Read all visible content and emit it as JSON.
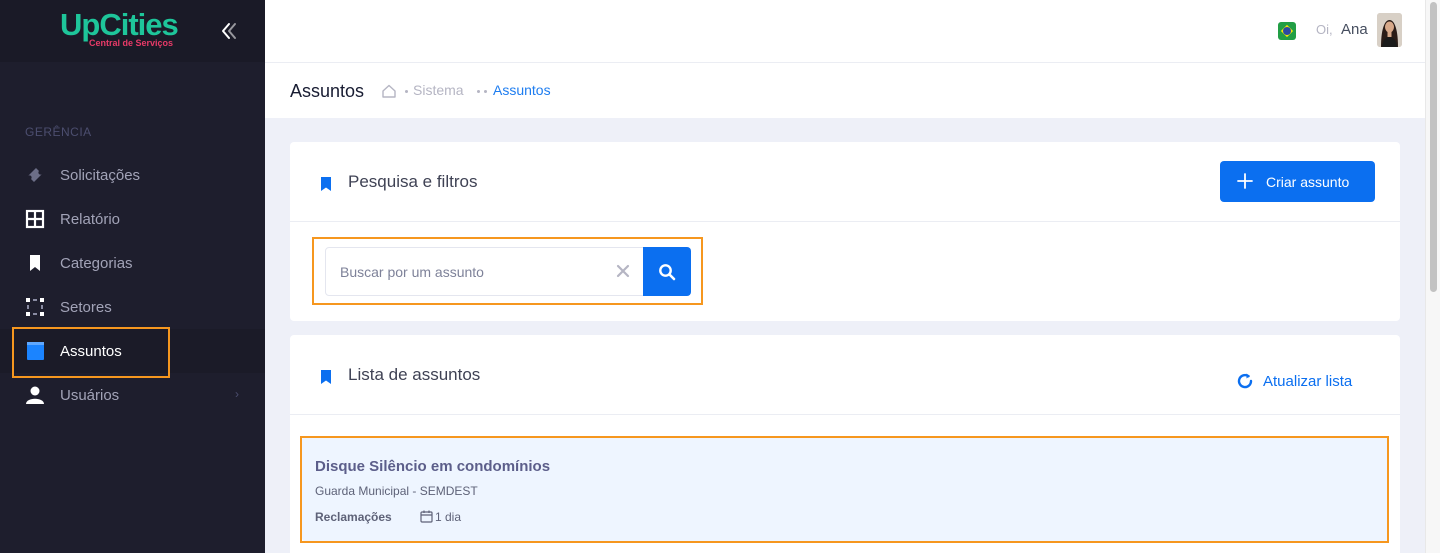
{
  "sidebar": {
    "logo": {
      "main": "UpCities",
      "sub": "Central de Serviços"
    },
    "section_label": "GERÊNCIA",
    "items": [
      {
        "label": "Solicitações",
        "icon": "ticket-icon"
      },
      {
        "label": "Relatório",
        "icon": "grid-icon"
      },
      {
        "label": "Categorias",
        "icon": "bookmark-icon"
      },
      {
        "label": "Setores",
        "icon": "dotted-square-icon"
      },
      {
        "label": "Assuntos",
        "icon": "book-icon",
        "active": true
      },
      {
        "label": "Usuários",
        "icon": "user-icon",
        "has_submenu": true
      }
    ],
    "submenu_arrow": "›"
  },
  "header": {
    "greeting": "Oi,",
    "user_name": "Ana",
    "flag": "brazil-flag-icon"
  },
  "subheader": {
    "title": "Assuntos",
    "breadcrumb": [
      "Sistema",
      "Assuntos"
    ]
  },
  "filters": {
    "title": "Pesquisa e filtros",
    "create_button": "Criar assunto",
    "search": {
      "placeholder": "Buscar por um assunto",
      "value": ""
    }
  },
  "list": {
    "title": "Lista de assuntos",
    "refresh_label": "Atualizar lista",
    "items": [
      {
        "title": "Disque Silêncio em condomínios",
        "sector": "Guarda Municipal - SEMDEST",
        "category": "Reclamações",
        "deadline": "1 dia"
      }
    ]
  },
  "colors": {
    "primary": "#0b6ff0",
    "sidebar_bg": "#1e1e2d",
    "highlight": "#f6971f",
    "logo_green": "#1ec59a",
    "logo_pink": "#e83a68"
  }
}
